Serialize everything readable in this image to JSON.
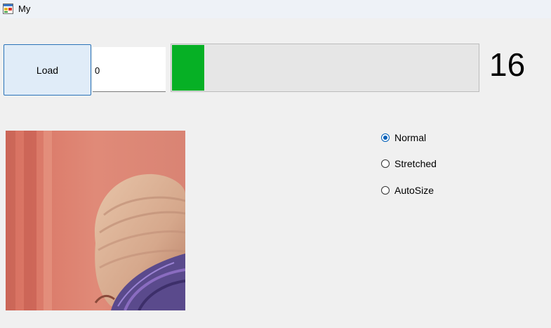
{
  "window": {
    "title": "My",
    "icon": "windows-form-icon"
  },
  "toolbar": {
    "load_label": "Load",
    "input_value": "0",
    "progress_fraction": 0.105,
    "counter_value": "16"
  },
  "picture": {
    "description_icon": "photo-image"
  },
  "size_mode": {
    "options": [
      {
        "label": "Normal",
        "checked": true
      },
      {
        "label": "Stretched",
        "checked": false
      },
      {
        "label": "AutoSize",
        "checked": false
      }
    ]
  },
  "colors": {
    "progress_fill": "#06b025",
    "accent": "#005fb8"
  }
}
